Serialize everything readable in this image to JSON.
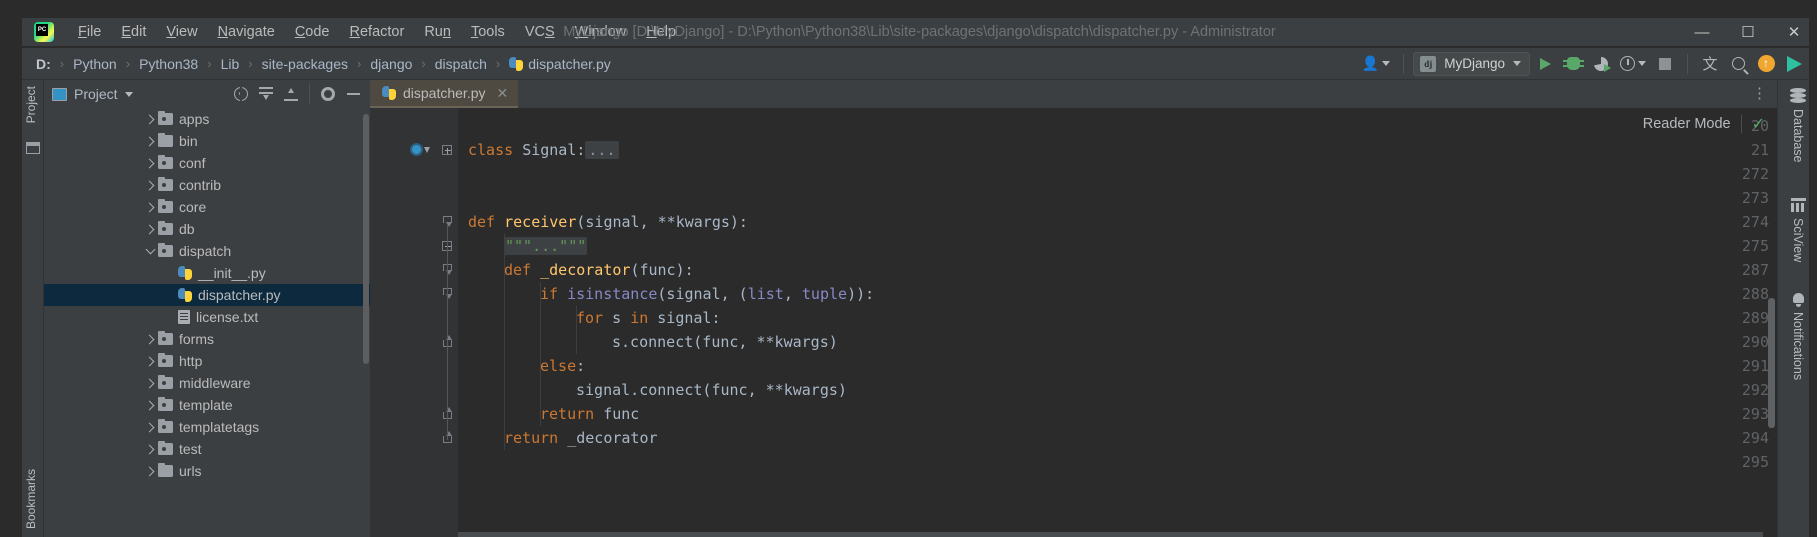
{
  "titlebar": {
    "app_icon": "pycharm-logo",
    "window_title": "MyDjango [D:\\MyDjango] - D:\\Python\\Python38\\Lib\\site-packages\\django\\dispatch\\dispatcher.py - Administrator",
    "menus": [
      {
        "label": "File",
        "mnemonic": "F"
      },
      {
        "label": "Edit",
        "mnemonic": "E"
      },
      {
        "label": "View",
        "mnemonic": "V"
      },
      {
        "label": "Navigate",
        "mnemonic": "N"
      },
      {
        "label": "Code",
        "mnemonic": "C"
      },
      {
        "label": "Refactor",
        "mnemonic": "R"
      },
      {
        "label": "Run",
        "mnemonic": "n"
      },
      {
        "label": "Tools",
        "mnemonic": "T"
      },
      {
        "label": "VCS",
        "mnemonic": "S"
      },
      {
        "label": "Window",
        "mnemonic": "W"
      },
      {
        "label": "Help",
        "mnemonic": "H"
      }
    ],
    "controls": {
      "minimize": "—",
      "maximize": "☐",
      "close": "✕"
    }
  },
  "navbar": {
    "breadcrumbs": [
      "D:",
      "Python",
      "Python38",
      "Lib",
      "site-packages",
      "django",
      "dispatch",
      "dispatcher.py"
    ],
    "separator": "›",
    "run_config": {
      "icon": "django-icon",
      "icon_text": "dj",
      "name": "MyDjango"
    },
    "buttons": [
      {
        "name": "user-account-button",
        "icon": "user-icon"
      },
      {
        "name": "run-button",
        "icon": "play-icon"
      },
      {
        "name": "debug-button",
        "icon": "bug-icon"
      },
      {
        "name": "run-with-coverage-button",
        "icon": "coverage-icon"
      },
      {
        "name": "profile-button",
        "icon": "profiler-icon"
      },
      {
        "name": "stop-button",
        "icon": "stop-icon"
      },
      {
        "name": "translate-button",
        "icon": "translate-icon"
      },
      {
        "name": "search-everywhere-button",
        "icon": "search-icon"
      },
      {
        "name": "update-button",
        "icon": "update-arrow-icon"
      },
      {
        "name": "toolbox-button",
        "icon": "toolbox-icon"
      }
    ]
  },
  "left_stripe": {
    "project_tab": "Project",
    "bookmarks_tab": "Bookmarks"
  },
  "project_panel": {
    "title": "Project",
    "toolbar": [
      {
        "name": "select-opened-file-button",
        "icon": "locate-icon"
      },
      {
        "name": "expand-all-button",
        "icon": "expand-all-icon"
      },
      {
        "name": "collapse-all-button",
        "icon": "collapse-all-icon"
      },
      {
        "name": "settings-button",
        "icon": "gear-icon"
      },
      {
        "name": "hide-button",
        "icon": "minus-icon"
      }
    ],
    "tree": [
      {
        "label": "apps",
        "type": "folder-module",
        "expanded": false,
        "indent": 2,
        "selected": false
      },
      {
        "label": "bin",
        "type": "folder",
        "expanded": false,
        "indent": 2,
        "selected": false
      },
      {
        "label": "conf",
        "type": "folder-module",
        "expanded": false,
        "indent": 2,
        "selected": false
      },
      {
        "label": "contrib",
        "type": "folder-module",
        "expanded": false,
        "indent": 2,
        "selected": false
      },
      {
        "label": "core",
        "type": "folder-module",
        "expanded": false,
        "indent": 2,
        "selected": false
      },
      {
        "label": "db",
        "type": "folder-module",
        "expanded": false,
        "indent": 2,
        "selected": false
      },
      {
        "label": "dispatch",
        "type": "folder-module",
        "expanded": true,
        "indent": 2,
        "selected": false
      },
      {
        "label": "__init__.py",
        "type": "python",
        "expanded": null,
        "indent": 3,
        "selected": false
      },
      {
        "label": "dispatcher.py",
        "type": "python",
        "expanded": null,
        "indent": 3,
        "selected": true
      },
      {
        "label": "license.txt",
        "type": "text",
        "expanded": null,
        "indent": 3,
        "selected": false
      },
      {
        "label": "forms",
        "type": "folder-module",
        "expanded": false,
        "indent": 2,
        "selected": false
      },
      {
        "label": "http",
        "type": "folder-module",
        "expanded": false,
        "indent": 2,
        "selected": false
      },
      {
        "label": "middleware",
        "type": "folder-module",
        "expanded": false,
        "indent": 2,
        "selected": false
      },
      {
        "label": "template",
        "type": "folder-module",
        "expanded": false,
        "indent": 2,
        "selected": false
      },
      {
        "label": "templatetags",
        "type": "folder-module",
        "expanded": false,
        "indent": 2,
        "selected": false
      },
      {
        "label": "test",
        "type": "folder-module",
        "expanded": false,
        "indent": 2,
        "selected": false
      },
      {
        "label": "urls",
        "type": "folder",
        "expanded": false,
        "indent": 2,
        "selected": false
      }
    ]
  },
  "editor": {
    "tab": {
      "label": "dispatcher.py",
      "icon": "python-file-icon",
      "close": "✕"
    },
    "kebab": "⋮",
    "reader_mode": {
      "label": "Reader Mode",
      "check": "✓"
    },
    "lines": [
      {
        "number": "20",
        "fold": "none",
        "indent": 0,
        "tokens": []
      },
      {
        "number": "21",
        "fold": "plus",
        "indent": 0,
        "gadget": true,
        "tokens": [
          {
            "t": "class ",
            "c": "kw"
          },
          {
            "t": "Signal",
            "c": "cls"
          },
          {
            "t": ":",
            "c": "par"
          },
          {
            "t": "...",
            "c": "fold-ph"
          }
        ]
      },
      {
        "number": "272",
        "fold": "none",
        "indent": 0,
        "tokens": []
      },
      {
        "number": "273",
        "fold": "none",
        "indent": 0,
        "tokens": []
      },
      {
        "number": "274",
        "fold": "arrow-dn",
        "indent": 0,
        "tokens": [
          {
            "t": "def ",
            "c": "kw"
          },
          {
            "t": "receiver",
            "c": "fn"
          },
          {
            "t": "(signal, ",
            "c": "par"
          },
          {
            "t": "**kwargs",
            "c": "par"
          },
          {
            "t": "):",
            "c": "par"
          }
        ]
      },
      {
        "number": "275",
        "fold": "plus",
        "indent": 1,
        "tokens": [
          {
            "t": "\"\"\"...\"\"\"",
            "c": "doc-ph"
          }
        ]
      },
      {
        "number": "287",
        "fold": "arrow-dn",
        "indent": 1,
        "tokens": [
          {
            "t": "def ",
            "c": "kw"
          },
          {
            "t": "_decorator",
            "c": "fn"
          },
          {
            "t": "(func):",
            "c": "par"
          }
        ]
      },
      {
        "number": "288",
        "fold": "arrow-dn",
        "indent": 2,
        "tokens": [
          {
            "t": "if ",
            "c": "kw"
          },
          {
            "t": "isinstance",
            "c": "bi"
          },
          {
            "t": "(signal, (",
            "c": "par"
          },
          {
            "t": "list",
            "c": "bi"
          },
          {
            "t": ", ",
            "c": "par"
          },
          {
            "t": "tuple",
            "c": "bi"
          },
          {
            "t": ")):",
            "c": "par"
          }
        ]
      },
      {
        "number": "289",
        "fold": "none",
        "indent": 3,
        "tokens": [
          {
            "t": "for ",
            "c": "kw"
          },
          {
            "t": "s ",
            "c": "par"
          },
          {
            "t": "in ",
            "c": "kw"
          },
          {
            "t": "signal:",
            "c": "par"
          }
        ]
      },
      {
        "number": "290",
        "fold": "arrow-up",
        "indent": 4,
        "tokens": [
          {
            "t": "s.connect(func, ",
            "c": "par"
          },
          {
            "t": "**kwargs",
            "c": "par"
          },
          {
            "t": ")",
            "c": "par"
          }
        ]
      },
      {
        "number": "291",
        "fold": "none",
        "indent": 2,
        "tokens": [
          {
            "t": "else",
            "c": "kw"
          },
          {
            "t": ":",
            "c": "par"
          }
        ]
      },
      {
        "number": "292",
        "fold": "none",
        "indent": 3,
        "tokens": [
          {
            "t": "signal.connect(func, ",
            "c": "par"
          },
          {
            "t": "**kwargs",
            "c": "par"
          },
          {
            "t": ")",
            "c": "par"
          }
        ]
      },
      {
        "number": "293",
        "fold": "arrow-up",
        "indent": 2,
        "tokens": [
          {
            "t": "return ",
            "c": "kw"
          },
          {
            "t": "func",
            "c": "par"
          }
        ]
      },
      {
        "number": "294",
        "fold": "arrow-up",
        "indent": 1,
        "tokens": [
          {
            "t": "return ",
            "c": "kw"
          },
          {
            "t": "_decorator",
            "c": "par"
          }
        ]
      },
      {
        "number": "295",
        "fold": "none",
        "indent": 0,
        "tokens": []
      }
    ]
  },
  "right_stripe": {
    "items": [
      {
        "label": "Database",
        "icon": "database-icon"
      },
      {
        "label": "SciView",
        "icon": "grid-icon"
      },
      {
        "label": "Notifications",
        "icon": "bell-icon"
      }
    ]
  },
  "colors": {
    "bg_editor": "#2b2b2b",
    "bg_chrome": "#3c3f41",
    "bg_panel": "#3c3f41",
    "selection": "#0d293e",
    "tab_active": "#4e4a41",
    "keyword": "#cc7832",
    "function": "#ffc66d",
    "builtin": "#8888c6",
    "text": "#a9b7c6",
    "accent_green": "#59a869",
    "line_number": "#606366"
  }
}
